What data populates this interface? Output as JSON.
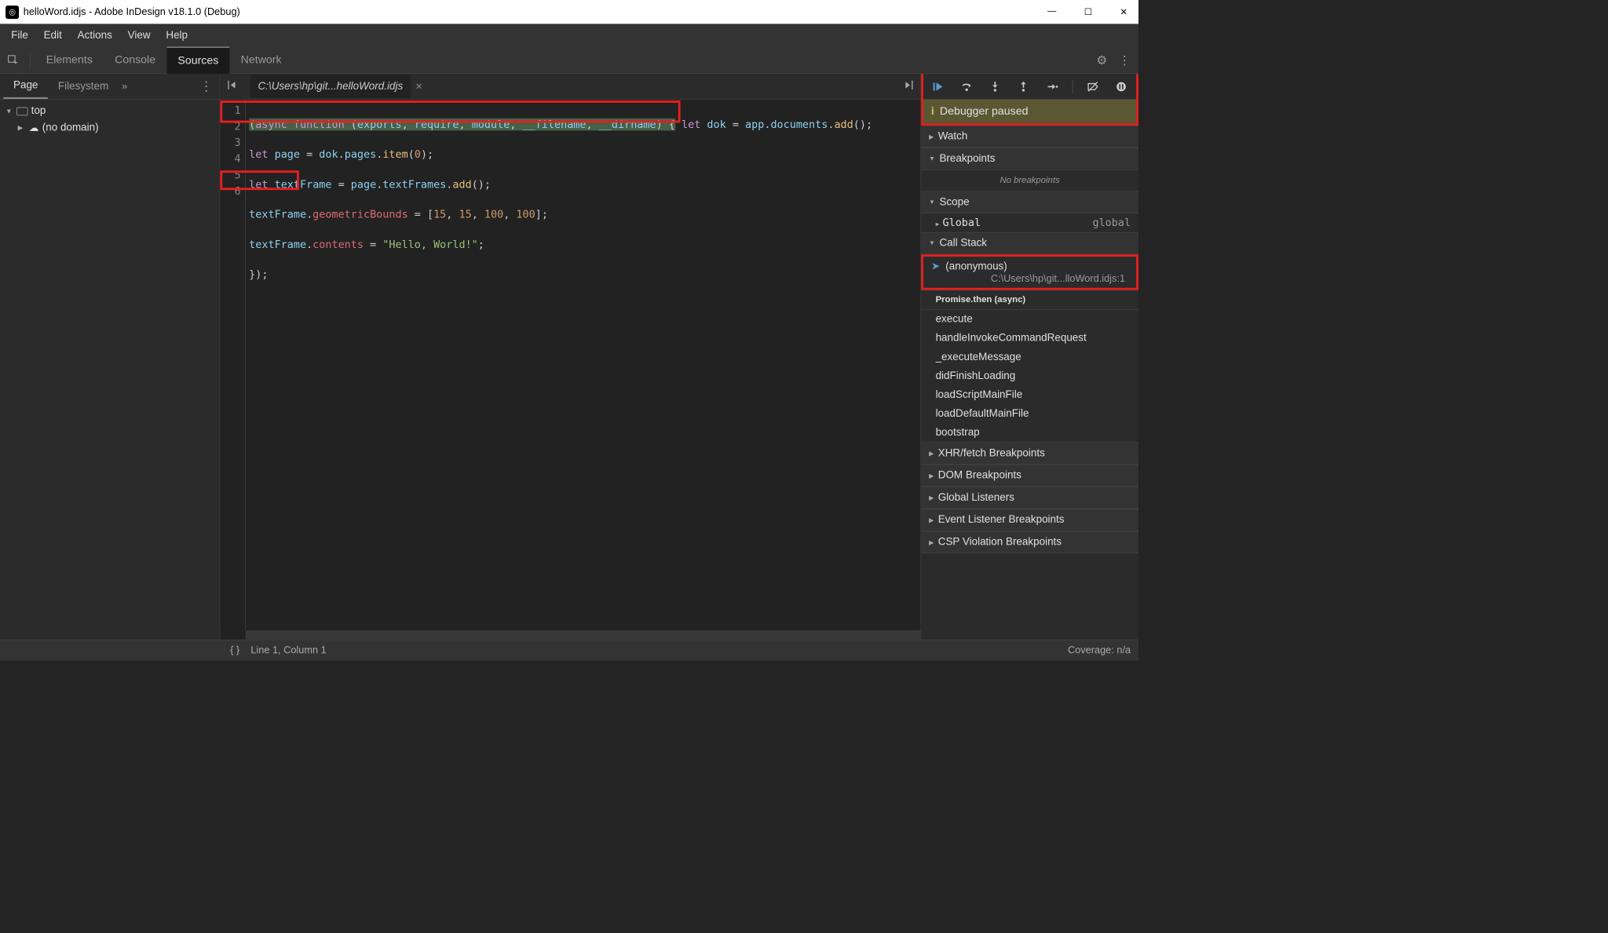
{
  "titlebar": {
    "title": "helloWord.idjs - Adobe InDesign v18.1.0 (Debug)"
  },
  "menubar": [
    "File",
    "Edit",
    "Actions",
    "View",
    "Help"
  ],
  "devtools_tabs": [
    "Elements",
    "Console",
    "Sources",
    "Network"
  ],
  "devtools_active": "Sources",
  "sidebar": {
    "tabs": [
      "Page",
      "Filesystem"
    ],
    "active": "Page",
    "tree_top": "top",
    "tree_item": "(no domain)"
  },
  "editor": {
    "filename": "C:\\Users\\hp\\git...helloWord.idjs",
    "lines": [
      1,
      2,
      3,
      4,
      5,
      6
    ]
  },
  "debugger": {
    "status": "Debugger paused",
    "sections": {
      "watch": "Watch",
      "breakpoints": "Breakpoints",
      "scope": "Scope",
      "callstack": "Call Stack",
      "xhr": "XHR/fetch Breakpoints",
      "dom": "DOM Breakpoints",
      "listeners": "Global Listeners",
      "event": "Event Listener Breakpoints",
      "csp": "CSP Violation Breakpoints"
    },
    "no_breakpoints": "No breakpoints",
    "scope_global_label": "Global",
    "scope_global_value": "global",
    "callstack": {
      "current_name": "(anonymous)",
      "current_loc": "C:\\Users\\hp\\git...lloWord.idjs:1",
      "async_label": "Promise.then (async)",
      "frames": [
        "execute",
        "handleInvokeCommandRequest",
        "_executeMessage",
        "didFinishLoading",
        "loadScriptMainFile",
        "loadDefaultMainFile",
        "bootstrap"
      ]
    }
  },
  "statusbar": {
    "position": "Line 1, Column 1",
    "coverage": "Coverage: n/a"
  }
}
